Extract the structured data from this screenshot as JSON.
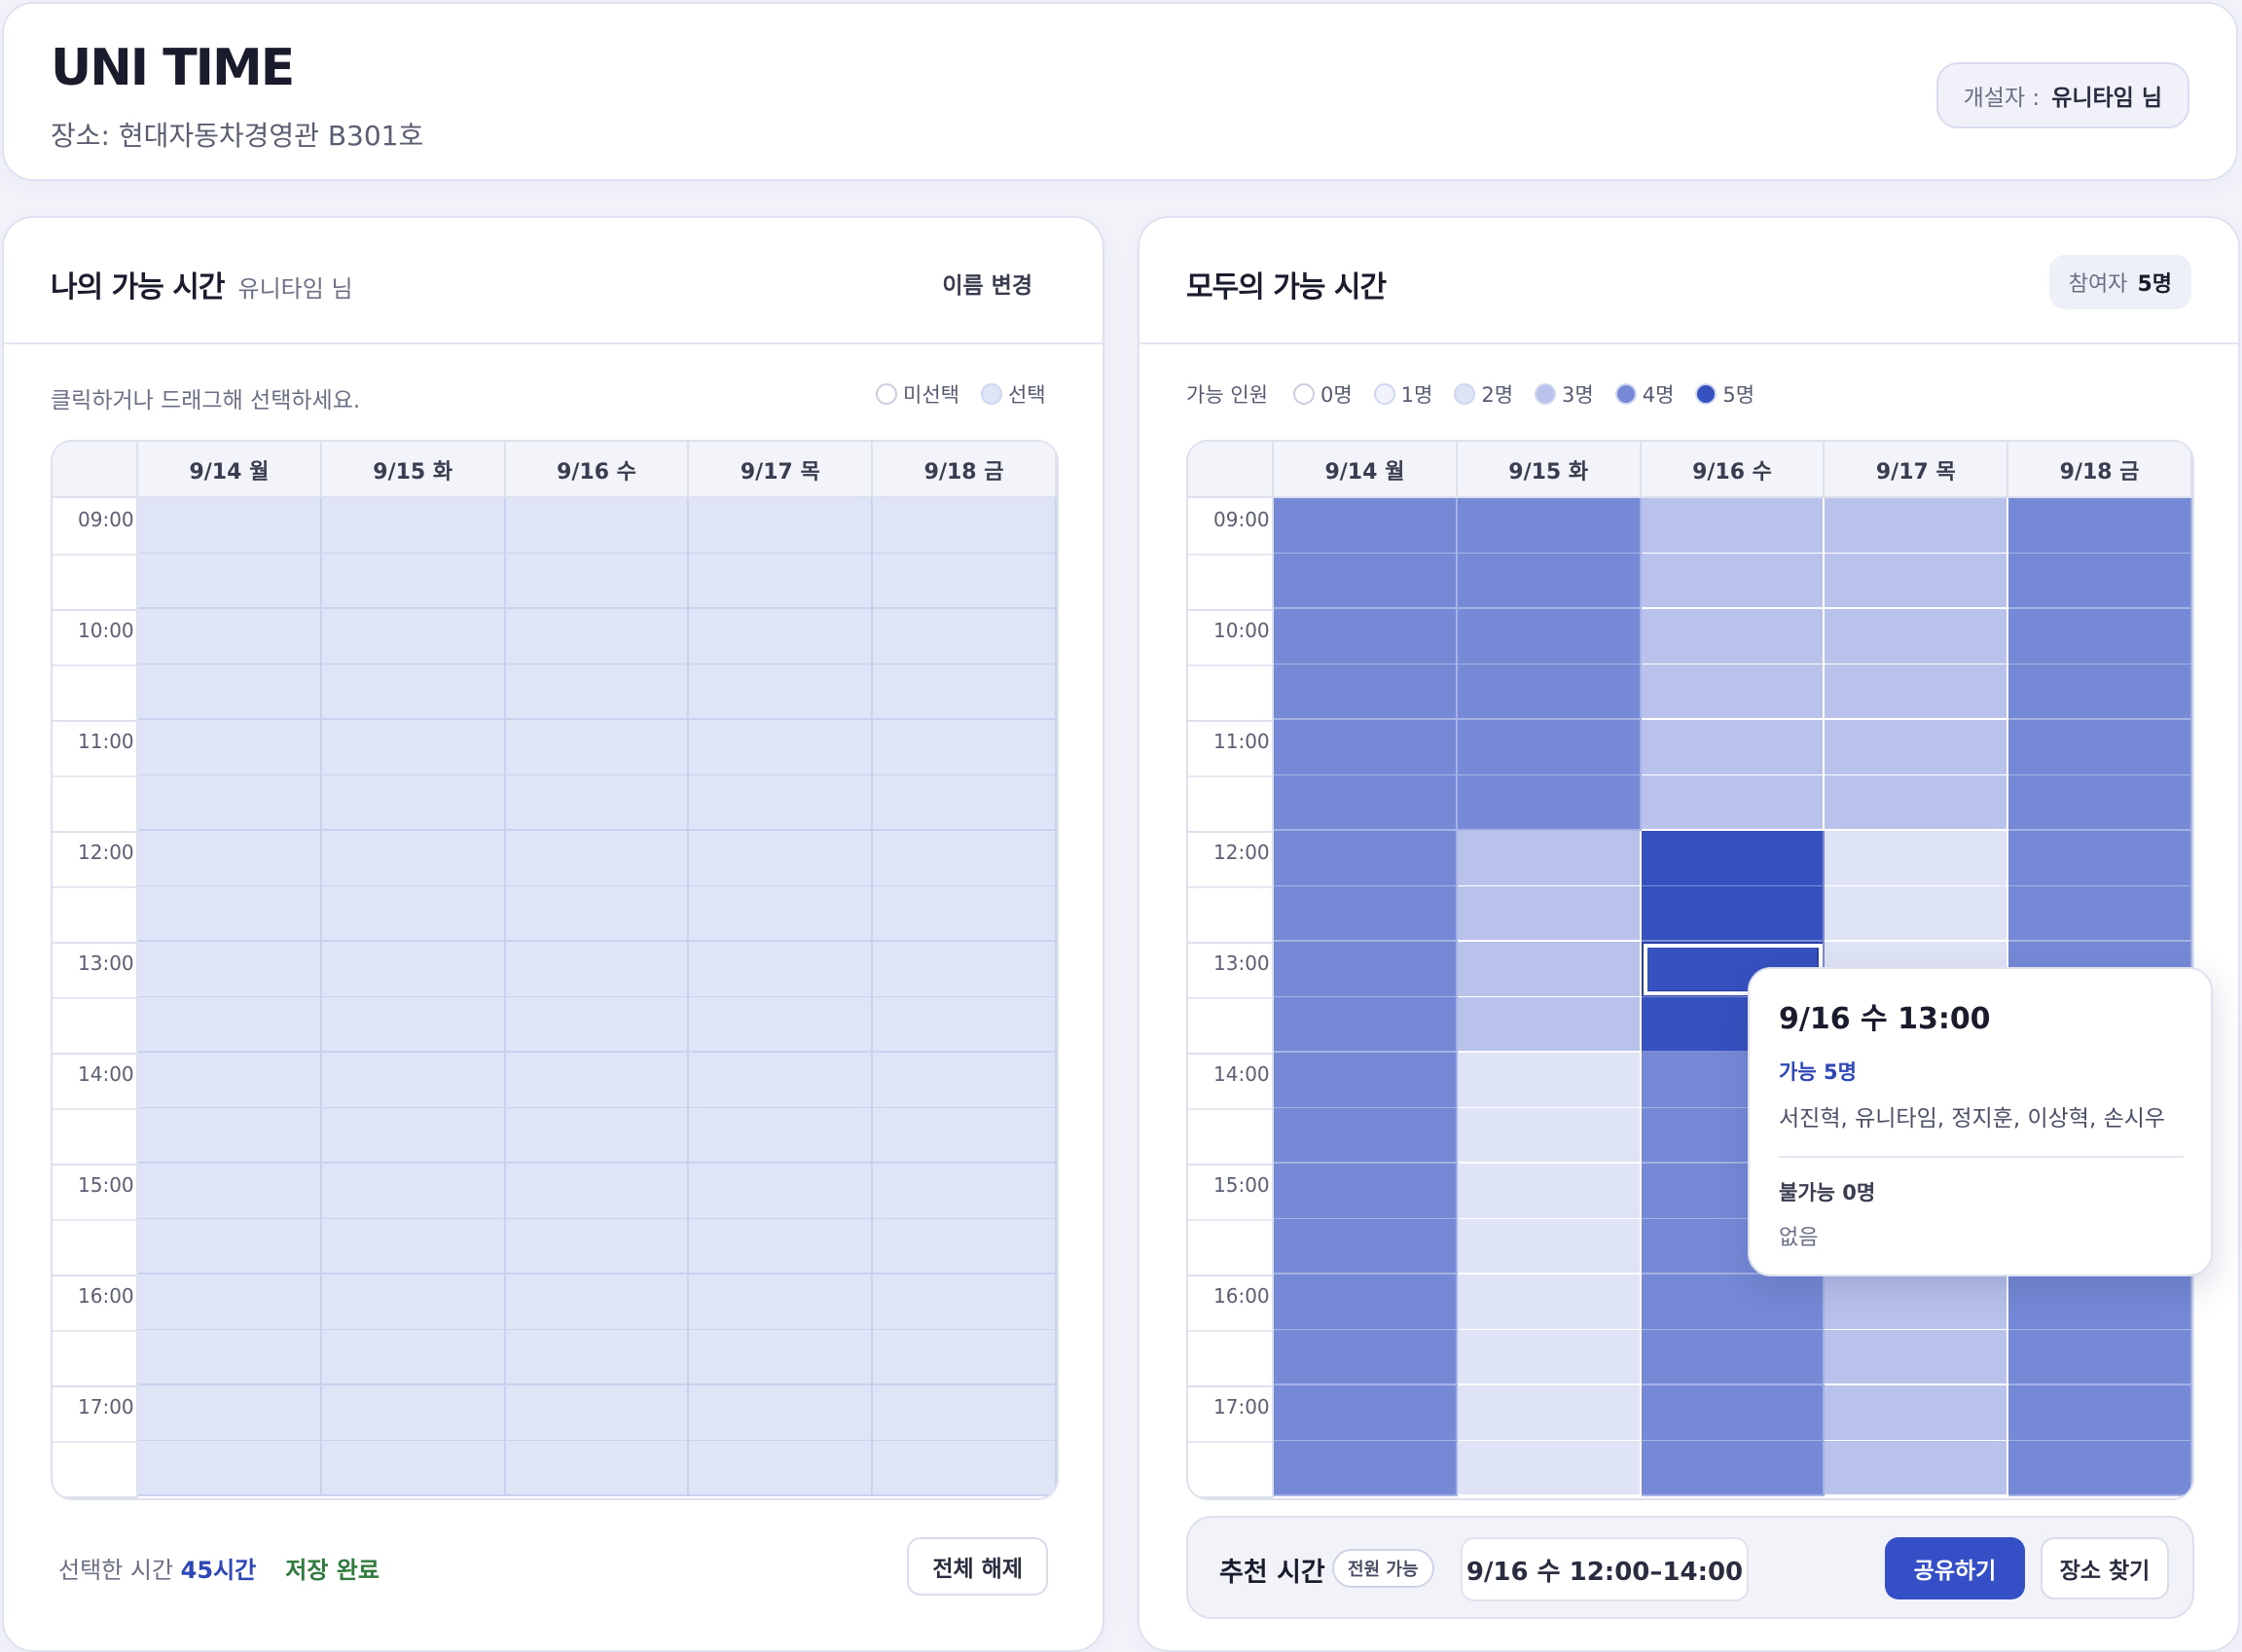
{
  "app": {
    "brand": "UNI TIME",
    "location": "장소: 현대자동차경영관 B301호",
    "creator_label": "개설자 :",
    "creator_name": "유니타임 님"
  },
  "my_panel": {
    "title": "나의 가능 시간",
    "user": "유니타임 님",
    "rename_label": "이름 변경",
    "hint": "클릭하거나 드래그해 선택하세요.",
    "legend": [
      {
        "label": "미선택",
        "color": "#ffffff"
      },
      {
        "label": "선택",
        "color": "#dfe5f7"
      }
    ],
    "selected_color": "#dfe5f7",
    "footer_label": "선택한 시간",
    "footer_hours": "45시간",
    "saved_label": "저장 완료",
    "clear_label": "전체 해제"
  },
  "all_panel": {
    "title": "모두의 가능 시간",
    "participants_label": "참여자",
    "participants_count": "5명",
    "legend_title": "가능 인원",
    "legend": [
      {
        "label": "0명",
        "color": "#ffffff"
      },
      {
        "label": "1명",
        "color": "#f1f2fa"
      },
      {
        "label": "2명",
        "color": "#dfe3f6"
      },
      {
        "label": "3명",
        "color": "#b8c2ea"
      },
      {
        "label": "4명",
        "color": "#7689d6"
      },
      {
        "label": "5명",
        "color": "#3651c0"
      }
    ],
    "availability": [
      [
        4,
        4,
        4,
        4,
        4,
        4,
        4,
        4,
        4,
        4,
        4,
        4,
        4,
        4,
        4,
        4,
        4,
        4
      ],
      [
        4,
        4,
        4,
        4,
        4,
        4,
        3,
        3,
        3,
        3,
        2,
        2,
        2,
        2,
        2,
        2,
        2,
        2
      ],
      [
        3,
        3,
        3,
        3,
        3,
        3,
        5,
        5,
        5,
        5,
        4,
        4,
        4,
        4,
        4,
        4,
        4,
        4
      ],
      [
        3,
        3,
        3,
        3,
        3,
        3,
        2,
        2,
        2,
        2,
        2,
        2,
        2,
        2,
        3,
        3,
        3,
        3
      ],
      [
        4,
        4,
        4,
        4,
        4,
        4,
        4,
        4,
        4,
        4,
        4,
        4,
        4,
        4,
        4,
        4,
        4,
        4
      ]
    ],
    "recommend_label": "추천 시간",
    "recommend_badge": "전원 가능",
    "recommend_time": "9/16 수 12:00–14:00",
    "share_label": "공유하기",
    "place_label": "장소 찾기"
  },
  "days": [
    "9/14 월",
    "9/15 화",
    "9/16 수",
    "9/17 목",
    "9/18 금"
  ],
  "times": [
    "09:00",
    "10:00",
    "11:00",
    "12:00",
    "13:00",
    "14:00",
    "15:00",
    "16:00",
    "17:00"
  ],
  "tooltip": {
    "title": "9/16 수 13:00",
    "available_label": "가능 5명",
    "available_names": "서진혁, 유니타임, 정지훈, 이상혁, 손시우",
    "unavailable_label": "불가능 0명",
    "unavailable_names": "없음"
  }
}
